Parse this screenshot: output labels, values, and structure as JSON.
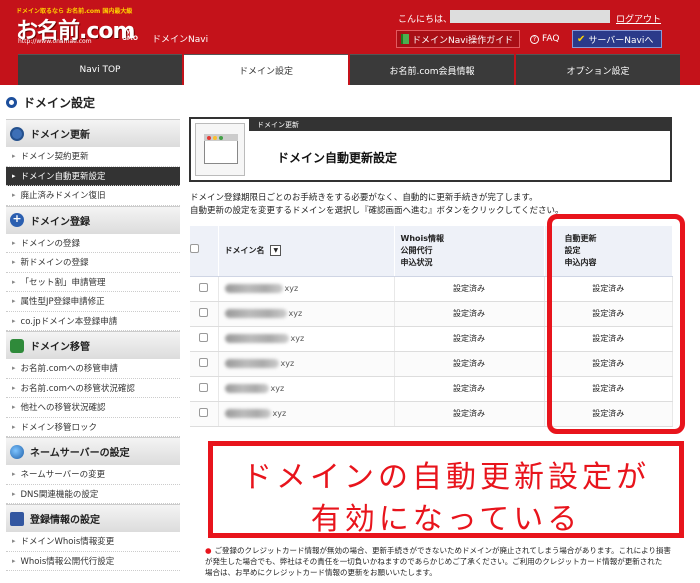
{
  "header": {
    "logo_tagline": "ドメイン取るなら お名前.com 国内最大級",
    "logo_name": "お名前.com",
    "logo_url": "http://www.onamae.com",
    "logo_gmo": "by GMO",
    "navi_label": "ドメインNavi",
    "greeting": "こんにちは、",
    "logout": "ログアウト",
    "guide_button": "ドメインNavi操作ガイド",
    "faq_button": "FAQ",
    "server_button": "サーバーNaviへ",
    "tabs": [
      {
        "label": "Navi TOP",
        "active": false
      },
      {
        "label": "ドメイン設定",
        "active": true
      },
      {
        "label": "お名前.com会員情報",
        "active": false
      },
      {
        "label": "オプション設定",
        "active": false
      }
    ]
  },
  "page_title": "ドメイン設定",
  "sidebar": {
    "sections": [
      {
        "title": "ドメイン更新",
        "icon": "gear-icon",
        "items": [
          "ドメイン契約更新",
          "ドメイン自動更新設定",
          "廃止済みドメイン復旧"
        ],
        "active_index": 1
      },
      {
        "title": "ドメイン登録",
        "icon": "plus-icon",
        "items": [
          "ドメインの登録",
          "新ドメインの登録",
          "「セット割」申請管理",
          "属性型JP登録申請修正",
          "co.jpドメイン本登録申請"
        ]
      },
      {
        "title": "ドメイン移管",
        "icon": "transfer-icon",
        "items": [
          "お名前.comへの移管申請",
          "お名前.comへの移管状況確認",
          "他社への移管状況確認",
          "ドメイン移管ロック"
        ]
      },
      {
        "title": "ネームサーバーの設定",
        "icon": "globe-icon",
        "items": [
          "ネームサーバーの変更",
          "DNS関連機能の設定"
        ]
      },
      {
        "title": "登録情報の設定",
        "icon": "document-icon",
        "items": [
          "ドメインWhois情報変更",
          "Whois情報公開代行設定"
        ]
      }
    ]
  },
  "main": {
    "section_label": "ドメイン更新",
    "title": "ドメイン自動更新設定",
    "description_line1": "ドメイン登録期限日ごとのお手続きをする必要がなく、自動的に更新手続きが完了します。",
    "description_line2": "自動更新の設定を変更するドメインを選択し『確認画面へ進む』ボタンをクリックしてください。",
    "table": {
      "headers": {
        "domain": "ドメイン名",
        "sort": "▼",
        "whois_l1": "Whois情報",
        "whois_l2": "公開代行",
        "whois_l3": "申込状況",
        "auto_l1": "自動更新",
        "auto_l2": "設定",
        "auto_l3": "申込内容"
      },
      "rows": [
        {
          "domain": "xyz",
          "whois": "設定済み",
          "auto": "設定済み"
        },
        {
          "domain": "xyz",
          "whois": "設定済み",
          "auto": "設定済み"
        },
        {
          "domain": "xyz",
          "whois": "設定済み",
          "auto": "設定済み"
        },
        {
          "domain": "xyz",
          "whois": "設定済み",
          "auto": "設定済み"
        },
        {
          "domain": "xyz",
          "whois": "設定済み",
          "auto": "設定済み"
        },
        {
          "domain": "xyz",
          "whois": "設定済み",
          "auto": "設定済み"
        }
      ]
    },
    "callout_line1": "ドメインの自動更新設定が",
    "callout_line2": "有効になっている",
    "note_line1": "ご登録のクレジットカード情報が無効の場合、更新手続きができないためドメインが廃止されてしまう場合があります。これにより損害",
    "note_line2": "が発生した場合でも、弊社はその責任を一切負いかねますのであらかじめご了承ください。ご利用のクレジットカード情報が更新された",
    "note_line3": "場合は、お早めにクレジットカード情報の更新をお願いいたします。"
  },
  "colors": {
    "brand_red": "#c4121a",
    "highlight_red": "#e8141c",
    "server_blue": "#2b3a8a"
  }
}
